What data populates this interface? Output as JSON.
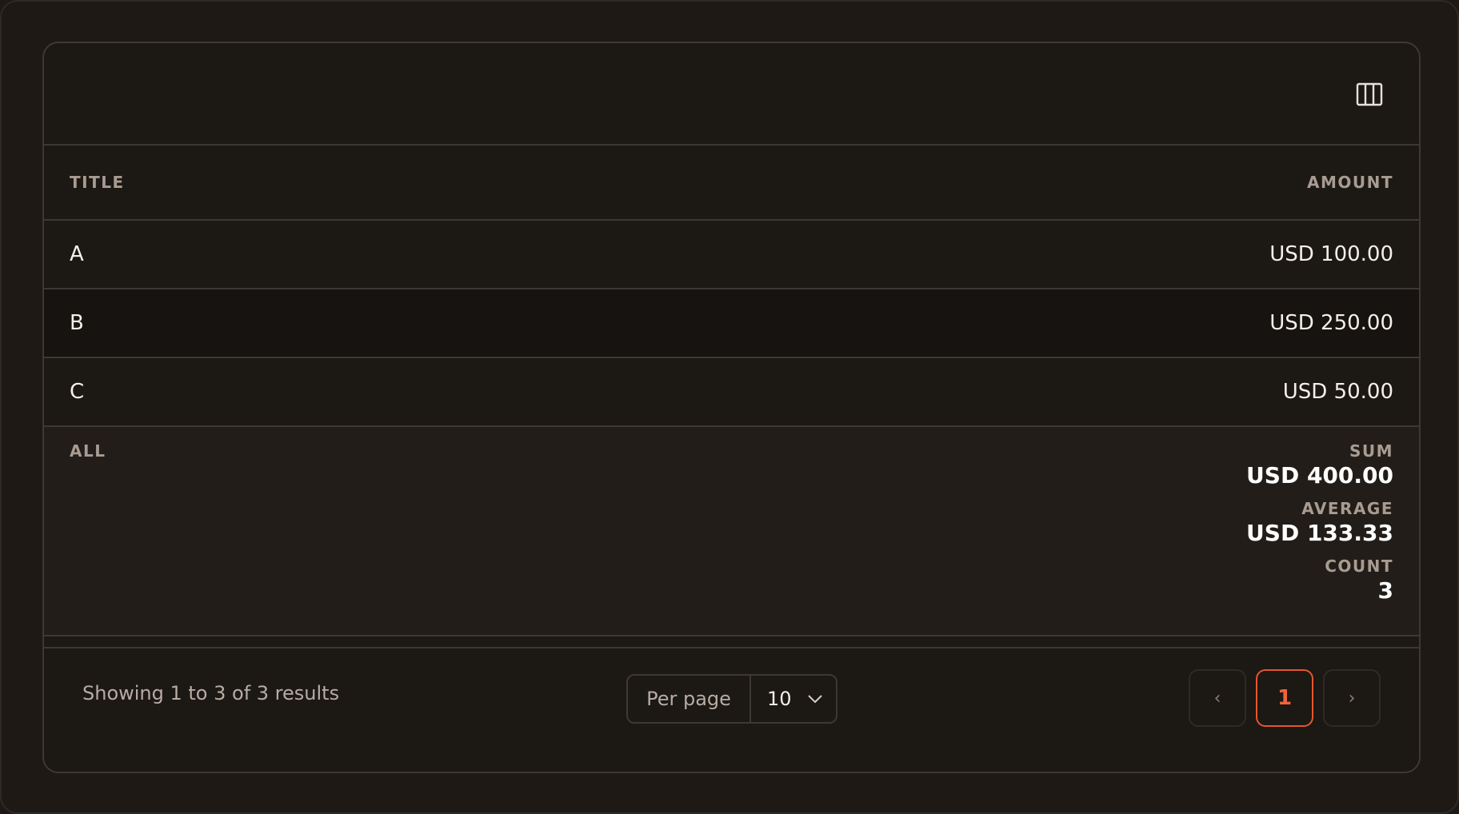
{
  "colors": {
    "accent": "#e4572e",
    "background": "#1e1915",
    "card": "#1c1814",
    "border": "#3d3833"
  },
  "toolbar": {
    "columns_icon": "columns-icon"
  },
  "table": {
    "headers": {
      "title": "TITLE",
      "amount": "AMOUNT"
    },
    "rows": [
      {
        "title": "A",
        "amount": "USD 100.00"
      },
      {
        "title": "B",
        "amount": "USD 250.00"
      },
      {
        "title": "C",
        "amount": "USD 50.00"
      }
    ],
    "summary": {
      "label": "ALL",
      "sum_label": "SUM",
      "sum_value": "USD 400.00",
      "average_label": "AVERAGE",
      "average_value": "USD 133.33",
      "count_label": "COUNT",
      "count_value": "3"
    }
  },
  "footer": {
    "results_text": "Showing 1 to 3 of 3 results",
    "per_page_label": "Per page",
    "per_page_value": "10",
    "prev": "‹",
    "current_page": "1",
    "next": "›"
  }
}
